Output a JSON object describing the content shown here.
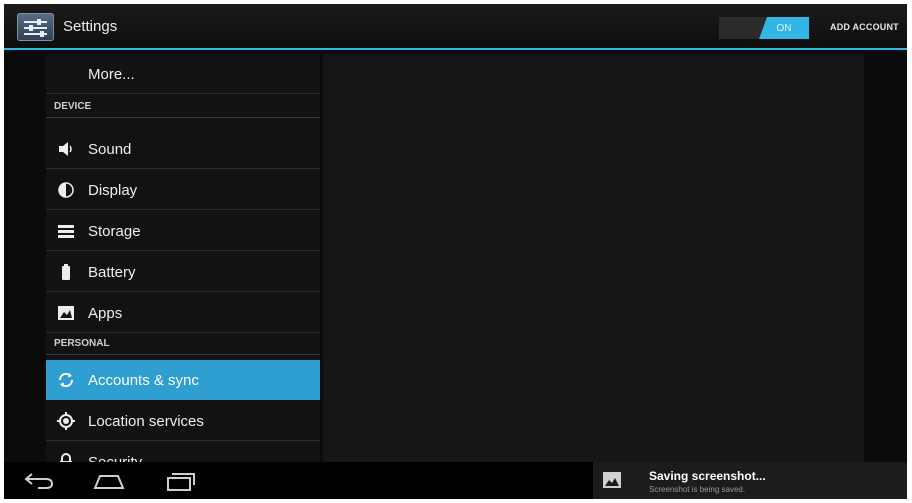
{
  "actionbar": {
    "title": "Settings",
    "toggle_label": "ON",
    "add_account_label": "ADD ACCOUNT",
    "accent_color": "#33b5e5"
  },
  "sidebar": {
    "items": [
      {
        "label": "More...",
        "icon": "none"
      },
      {
        "label": "DEVICE",
        "type": "header"
      },
      {
        "label": "Sound",
        "icon": "speaker-icon"
      },
      {
        "label": "Display",
        "icon": "brightness-icon"
      },
      {
        "label": "Storage",
        "icon": "storage-icon"
      },
      {
        "label": "Battery",
        "icon": "battery-icon"
      },
      {
        "label": "Apps",
        "icon": "apps-icon"
      },
      {
        "label": "PERSONAL",
        "type": "header"
      },
      {
        "label": "Accounts & sync",
        "icon": "sync-icon",
        "selected": true
      },
      {
        "label": "Location services",
        "icon": "location-icon"
      },
      {
        "label": "Security",
        "icon": "lock-icon"
      }
    ],
    "selected_color": "#2f9ed0"
  },
  "notification": {
    "title": "Saving screenshot...",
    "subtitle": "Screenshot is being saved."
  },
  "navbar": {
    "buttons": [
      "back-icon",
      "home-icon",
      "recent-apps-icon"
    ]
  }
}
